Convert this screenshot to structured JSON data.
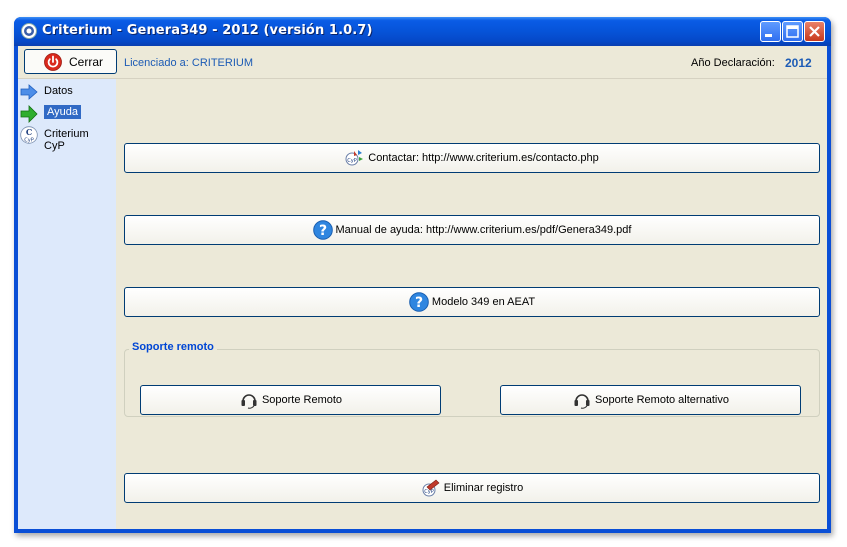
{
  "window": {
    "title": "Criterium - Genera349 - 2012 (versión 1.0.7)"
  },
  "toolbar": {
    "close_label": "Cerrar",
    "licensee": "Licenciado a: CRITERIUM",
    "year_label": "Año Declaración:",
    "year_value": "2012"
  },
  "sidebar": {
    "items": [
      {
        "label": "Datos",
        "icon": "blue-arrow-icon"
      },
      {
        "label": "Ayuda",
        "icon": "green-arrow-icon",
        "selected": true
      },
      {
        "label": "Criterium CyP",
        "icon": "criterium-cyp-icon"
      }
    ]
  },
  "main": {
    "contact_label": "Contactar: http://www.criterium.es/contacto.php",
    "manual_label": "Manual de ayuda: http://www.criterium.es/pdf/Genera349.pdf",
    "aeat_label": "Modelo 349 en AEAT",
    "remote_group_title": "Soporte remoto",
    "remote_label": "Soporte Remoto",
    "remote_alt_label": "Soporte Remoto alternativo",
    "delete_label": "Eliminar registro"
  },
  "colors": {
    "titlebar": "#0653d8",
    "accent_text": "#1c5bb5",
    "sidebar_bg": "#dde9fb",
    "selection": "#316ac5",
    "client_bg": "#ece9d8"
  }
}
